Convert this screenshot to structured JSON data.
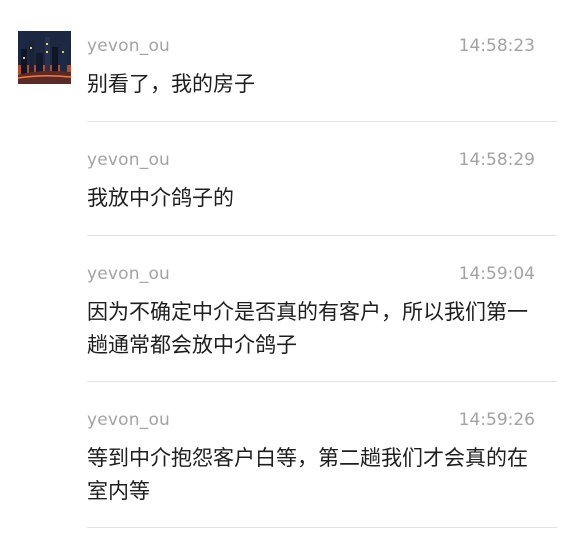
{
  "messages": [
    {
      "sender": "yevon_ou",
      "time": "14:58:23",
      "text": "别看了，我的房子",
      "avatar": "city-night-avatar-icon"
    },
    {
      "sender": "yevon_ou",
      "time": "14:58:29",
      "text": "我放中介鸽子的"
    },
    {
      "sender": "yevon_ou",
      "time": "14:59:04",
      "text": "因为不确定中介是否真的有客户，所以我们第一趟通常都会放中介鸽子"
    },
    {
      "sender": "yevon_ou",
      "time": "14:59:26",
      "text": "等到中介抱怨客户白等，第二趟我们才会真的在室内等"
    }
  ],
  "colors": {
    "meta_text": "#a3a3a3",
    "body_text": "#1e1e1e",
    "divider": "#e3e3e3",
    "background": "#ffffff"
  }
}
